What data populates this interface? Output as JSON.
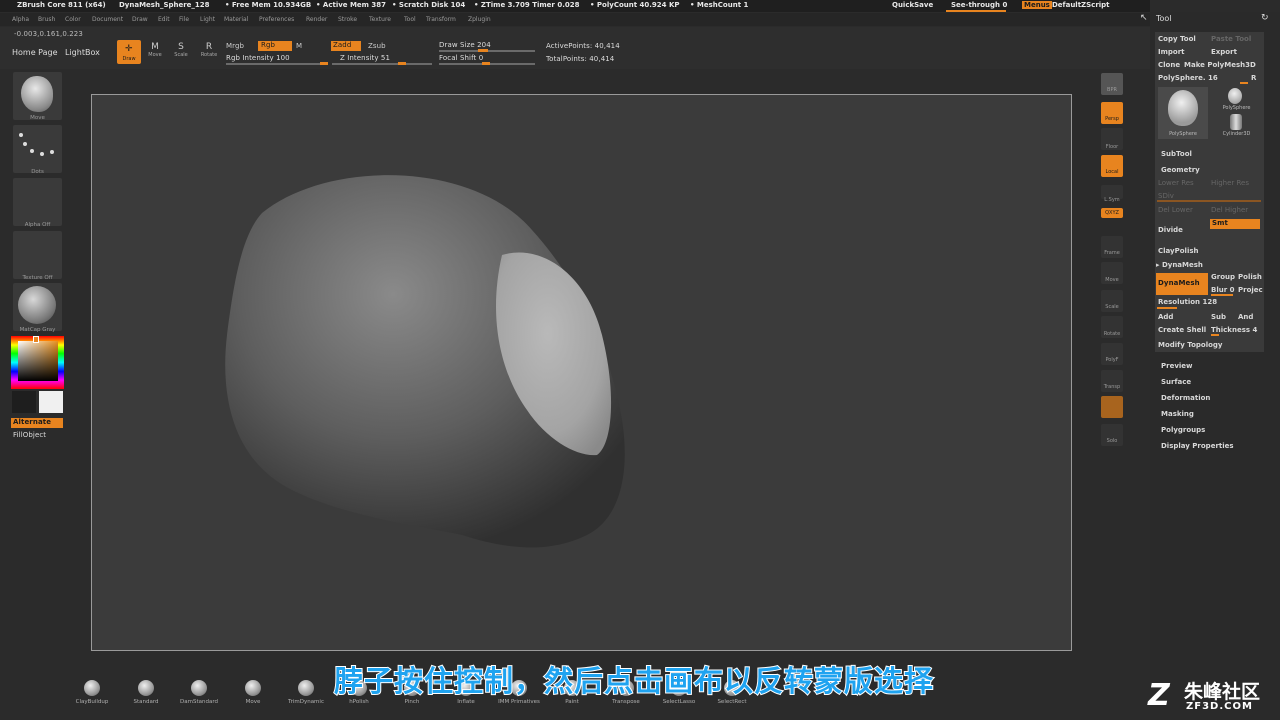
{
  "titlebar": {
    "app": "ZBrush Core 811 (x64)",
    "doc": "DynaMesh_Sphere_128",
    "free_mem": "• Free Mem 10.934GB",
    "active_mem": "• Active Mem 387",
    "scratch": "• Scratch Disk 104",
    "ztime": "• ZTime 3.709  Timer 0.028",
    "polycount": "• PolyCount 40.924 KP",
    "meshcount": "• MeshCount 1",
    "quicksave": "QuickSave",
    "see_through": "See-through  0",
    "menus": "Menus",
    "default_script": "DefaultZScript"
  },
  "menubar": [
    "Alpha",
    "Brush",
    "Color",
    "Document",
    "Draw",
    "Edit",
    "File",
    "Light",
    "Material",
    "Preferences",
    "Render",
    "Stroke",
    "Texture",
    "Tool",
    "Transform",
    "Zplugin"
  ],
  "coords": "-0.003,0.161,0.223",
  "toolbar": {
    "home": "Home Page",
    "lightbox": "LightBox",
    "draw": "Draw",
    "move": "Move",
    "scale": "Scale",
    "rotate": "Rotate",
    "mrgb": "Mrgb",
    "rgb": "Rgb",
    "m": "M",
    "rgb_intensity": "Rgb Intensity 100",
    "zadd": "Zadd",
    "zsub": "Zsub",
    "z_intensity": "Z Intensity 51",
    "draw_size": "Draw Size 204",
    "focal_shift": "Focal Shift 0",
    "active_points": "ActivePoints: 40,414",
    "total_points": "TotalPoints: 40,414"
  },
  "left_shelf": {
    "move": "Move",
    "dots": "Dots",
    "alpha": "Alpha Off",
    "texture": "Texture Off",
    "matcap": "MatCap Gray",
    "alternate": "Alternate",
    "fillobject": "FillObject"
  },
  "right_shelf": [
    "BPR",
    "Persp",
    "Floor",
    "Local",
    "L.Sym",
    "QXYZ",
    "Frame",
    "Move",
    "Scale",
    "Rotate",
    "PolyF",
    "Transp",
    "Solo"
  ],
  "tool_panel": {
    "title": "Tool",
    "copy_tool": "Copy Tool",
    "paste_tool": "Paste Tool",
    "import": "Import",
    "export": "Export",
    "clone": "Clone",
    "make_polymesh": "Make PolyMesh3D",
    "polysphere_slider": "PolySphere. 16",
    "r": "R",
    "thumb1": "PolySphere",
    "thumb2": "PolySphere",
    "thumb3": "Cylinder3D",
    "subtool": "SubTool",
    "geometry": "Geometry",
    "lower_res": "Lower Res",
    "higher_res": "Higher Res",
    "sdiv": "SDiv",
    "del_lower": "Del Lower",
    "del_higher": "Del Higher",
    "divide": "Divide",
    "smt": "Smt",
    "claypolish": "ClayPolish",
    "dynamesh_header": "▸ DynaMesh",
    "dynamesh_btn": "DynaMesh",
    "group": "Group",
    "polish": "Polish",
    "blur": "Blur 0",
    "project": "Projec",
    "resolution": "Resolution 128",
    "add": "Add",
    "sub": "Sub",
    "and": "And",
    "create_shell": "Create Shell",
    "thickness": "Thickness 4",
    "modify_topology": "Modify Topology",
    "preview": "Preview",
    "surface": "Surface",
    "deformation": "Deformation",
    "masking": "Masking",
    "polygroups": "Polygroups",
    "display_properties": "Display Properties"
  },
  "brushes": [
    "ClayBuildup",
    "Standard",
    "DamStandard",
    "Move",
    "TrimDynamic",
    "hPolish",
    "Pinch",
    "Inflate",
    "IMM Primatives",
    "Paint",
    "Transpose",
    "SelectLasso",
    "SelectRect"
  ],
  "subtitle": "脖子按住控制，然后点击画布以反转蒙版选择",
  "watermark": {
    "main": "朱峰社区",
    "sub": "ZF3D.COM"
  },
  "colors": {
    "accent": "#e8841f",
    "subtitle": "#1fa3f0"
  }
}
